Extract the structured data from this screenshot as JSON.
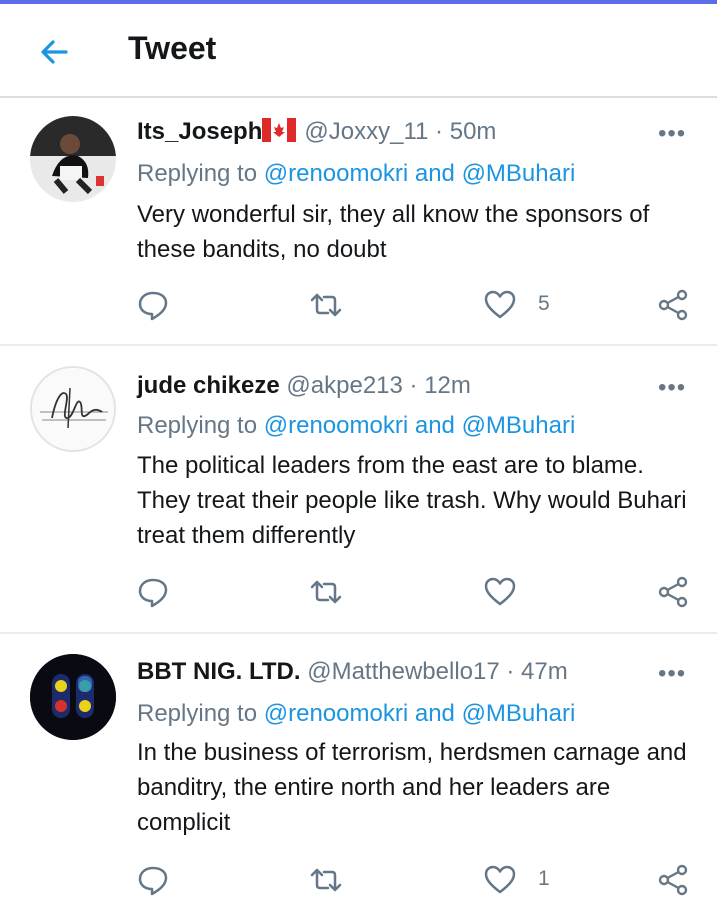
{
  "header": {
    "title": "Tweet"
  },
  "colors": {
    "accent": "#1b95e0",
    "muted": "#657786",
    "text": "#14171a"
  },
  "tweets": [
    {
      "name": "Its_Joseph",
      "flag_icon": "canada-flag",
      "handle": "@Joxxy_11",
      "sep": "·",
      "time": "50m",
      "replying_prefix": "Replying to",
      "reply_to_1": "@renoomokri",
      "reply_and": "and",
      "reply_to_2": "@MBuhari",
      "text": "Very wonderful sir, they all know the sponsors of these bandits, no doubt",
      "likes": "5",
      "more": "•••"
    },
    {
      "name": "jude chikeze",
      "handle": "@akpe213",
      "sep": "·",
      "time": "12m",
      "replying_prefix": "Replying to",
      "reply_to_1": "@renoomokri",
      "reply_and": "and",
      "reply_to_2": "@MBuhari",
      "text": "The political leaders from the east are to blame. They treat their people like trash. Why would Buhari treat them differently",
      "likes": "",
      "more": "•••"
    },
    {
      "name": "BBT NIG. LTD.",
      "handle": "@Matthewbello17",
      "sep": "·",
      "time": "47m",
      "replying_prefix": "Replying to",
      "reply_to_1": "@renoomokri",
      "reply_and": "and",
      "reply_to_2": "@MBuhari",
      "text": "In the business of terrorism, herdsmen carnage and banditry, the entire north and her leaders are complicit",
      "likes": "1",
      "more": "•••"
    }
  ]
}
